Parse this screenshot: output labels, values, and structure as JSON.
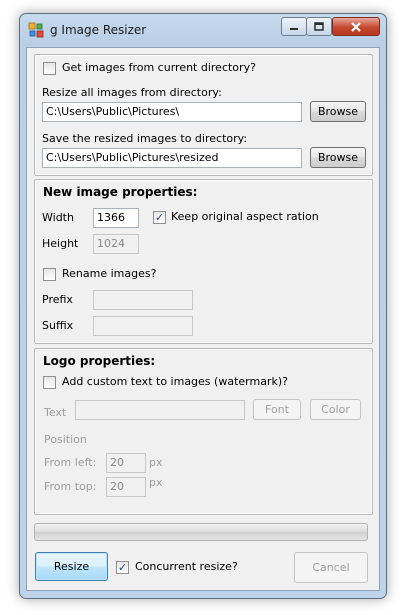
{
  "window": {
    "title": "g Image Resizer"
  },
  "source": {
    "current_dir_label": "Get images from current directory?",
    "current_dir_checked": false,
    "resize_from_label": "Resize all images from directory:",
    "resize_from_value": "C:\\Users\\Public\\Pictures\\",
    "browse_label": "Browse",
    "save_to_label": "Save the resized images to directory:",
    "save_to_value": "C:\\Users\\Public\\Pictures\\resized"
  },
  "image_properties": {
    "heading": "New image properties:",
    "width_label": "Width",
    "width_value": "1366",
    "keep_aspect_label": "Keep original aspect ration",
    "keep_aspect_checked": true,
    "height_label": "Height",
    "height_value": "1024",
    "rename_label": "Rename images?",
    "rename_checked": false,
    "prefix_label": "Prefix",
    "suffix_label": "Suffix"
  },
  "logo_properties": {
    "heading": "Logo properties:",
    "watermark_label": "Add custom text to images (watermark)?",
    "watermark_checked": false,
    "text_label": "Text",
    "font_button": "Font",
    "color_button": "Color",
    "position_label": "Position",
    "from_left_label": "From left:",
    "from_left_value": "20",
    "from_left_unit": "px",
    "from_top_label": "From top:",
    "from_top_value": "20",
    "from_top_unit": "px"
  },
  "progress": {
    "fraction": 0
  },
  "footer": {
    "resize_button": "Resize",
    "concurrent_label": "Concurrent resize?",
    "concurrent_checked": true,
    "cancel_button": "Cancel"
  },
  "colors": {
    "title_bar": "#c7daee",
    "close_button": "#c6472f",
    "check_mark": "#21417a"
  },
  "icons": {
    "app": "app-icon",
    "minimize": "minimize-icon",
    "maximize": "maximize-icon",
    "close": "close-icon",
    "check": "checkmark-icon"
  }
}
